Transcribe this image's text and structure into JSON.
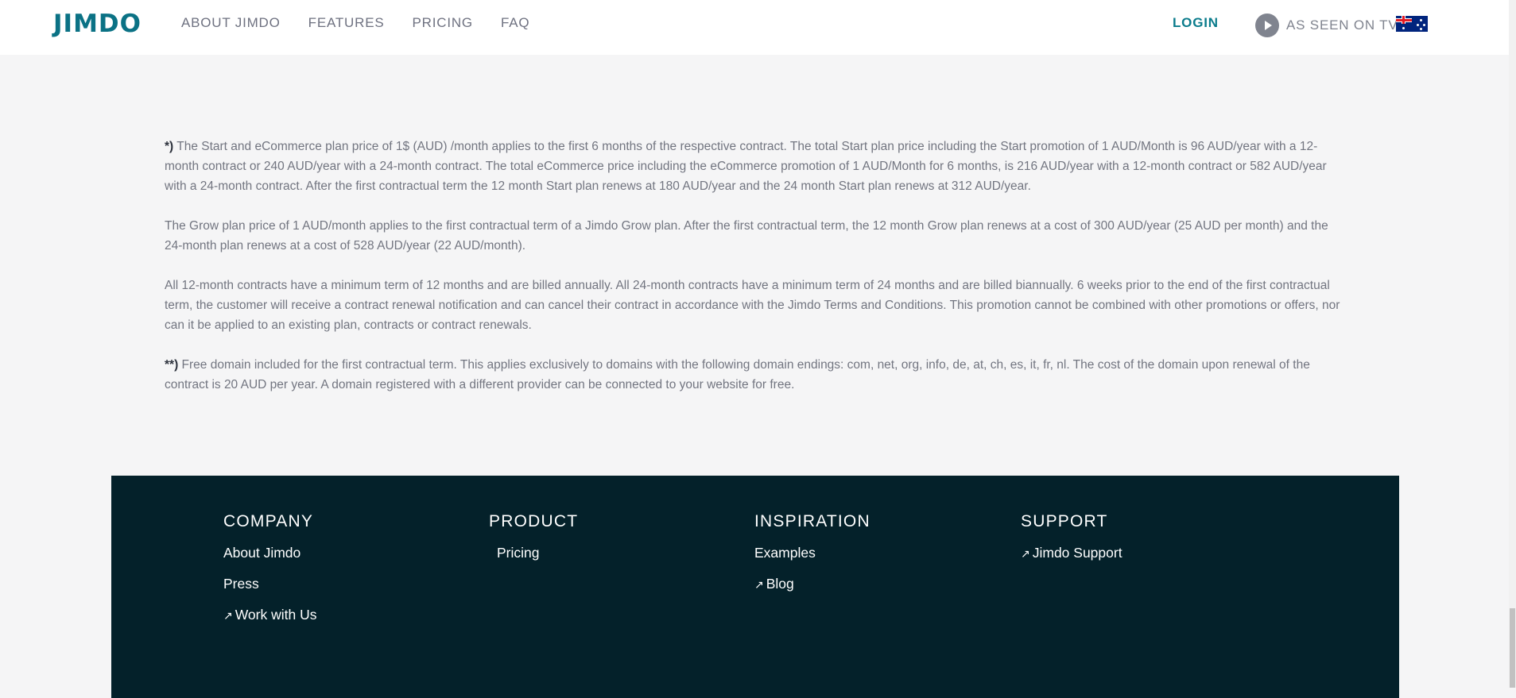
{
  "header": {
    "logo": "JIMDO",
    "nav": [
      "ABOUT JIMDO",
      "FEATURES",
      "PRICING",
      "FAQ"
    ],
    "login": "LOGIN",
    "tv_label": "AS SEEN ON TV",
    "flag_icon": "australia-flag-icon",
    "brand_color": "#0b7285"
  },
  "legal": {
    "p1_mark": "*)",
    "p1": " The Start and eCommerce plan price of 1$ (AUD) /month applies to the first 6 months of the respective contract. The total Start plan price including the Start promotion of 1 AUD/Month is 96 AUD/year with a 12-month contract or 240 AUD/year with a 24-month contract. The total eCommerce price including the eCommerce promotion of 1 AUD/Month for 6 months, is 216 AUD/year with a 12-month contract or 582 AUD/year with a 24-month contract. After the first contractual term the 12 month Start plan renews at 180 AUD/year and the 24 month Start plan renews at 312 AUD/year.",
    "p2": "The Grow plan price of 1 AUD/month applies to the first contractual term of a Jimdo Grow plan. After the first contractual term, the 12 month Grow plan renews at a cost of 300 AUD/year (25 AUD per month) and the 24-month plan renews at a cost of 528 AUD/year (22 AUD/month).",
    "p3": "All 12-month contracts have a minimum term of 12 months and are billed annually. All 24-month contracts have a minimum term of 24 months and are billed biannually. 6 weeks prior to the end of the first contractual term, the customer will receive a contract renewal notification and can cancel their contract in accordance with the Jimdo Terms and Conditions. This promotion cannot be combined with other promotions or offers, nor can it be applied to an existing plan, contracts or contract renewals.",
    "p4_mark": "**)",
    "p4": " Free domain included for the first contractual term. This applies exclusively to domains with the following domain endings: com, net, org, info, de, at, ch, es, it, fr, nl. The cost of the domain upon renewal of the contract is 20 AUD per year. A domain registered with a different provider can be connected to your website for free."
  },
  "footer": {
    "company": {
      "title": "COMPANY",
      "links": [
        "About Jimdo",
        "Press",
        "Work with Us"
      ]
    },
    "product": {
      "title": "PRODUCT",
      "links": [
        "Pricing"
      ]
    },
    "inspiration": {
      "title": "INSPIRATION",
      "links": [
        "Examples",
        "Blog"
      ]
    },
    "support": {
      "title": "SUPPORT",
      "links": [
        "Jimdo Support"
      ]
    },
    "external_icon": "external-link-arrow-icon",
    "background_color": "#04212a"
  }
}
